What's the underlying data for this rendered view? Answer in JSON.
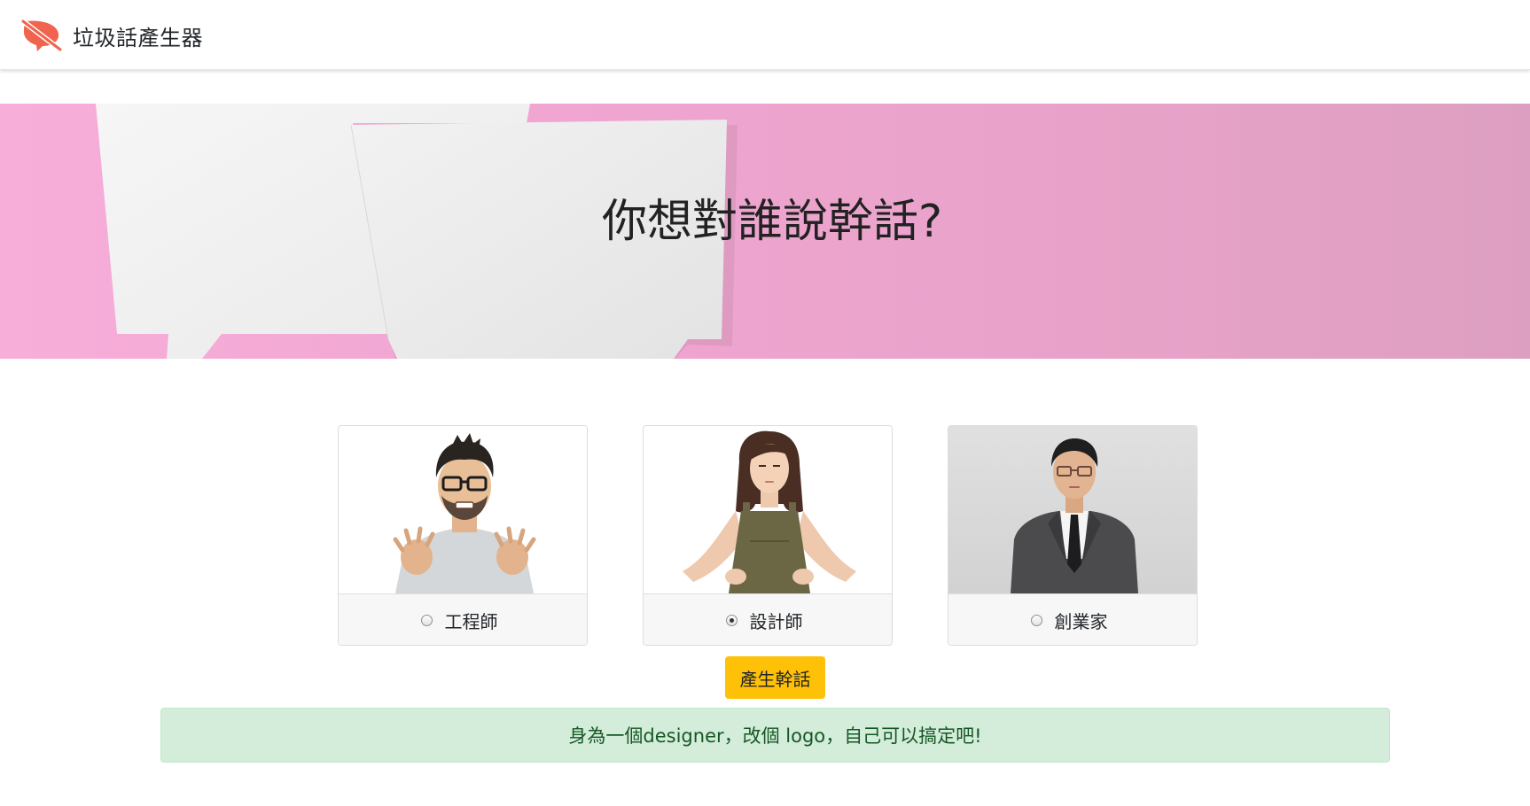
{
  "navbar": {
    "brand_title": "垃圾話產生器",
    "brand_icon": "muted-speech-bubble-icon",
    "brand_color": "#f0644f"
  },
  "hero": {
    "title": "你想對誰說幹話?"
  },
  "options": [
    {
      "label": "工程師",
      "value": "engineer",
      "checked": false
    },
    {
      "label": "設計師",
      "value": "designer",
      "checked": true
    },
    {
      "label": "創業家",
      "value": "entrepreneur",
      "checked": false
    }
  ],
  "generate_button": {
    "label": "產生幹話",
    "color": "#ffc107"
  },
  "result": {
    "text": "身為一個designer，改個 logo，自己可以搞定吧!",
    "background": "#d4edda",
    "text_color": "#155724"
  }
}
